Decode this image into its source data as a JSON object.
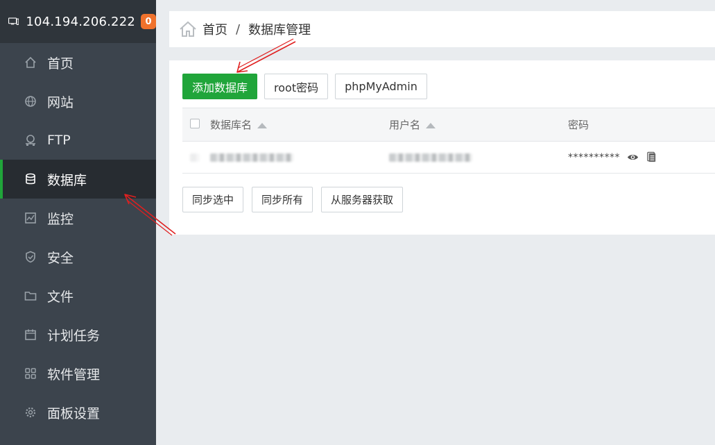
{
  "header": {
    "ip": "104.194.206.222",
    "badge": "0",
    "icon": "monitor-icon"
  },
  "sidebar": {
    "items": [
      {
        "label": "首页",
        "icon": "home-icon",
        "active": false
      },
      {
        "label": "网站",
        "icon": "globe-icon",
        "active": false
      },
      {
        "label": "FTP",
        "icon": "ftp-icon",
        "active": false
      },
      {
        "label": "数据库",
        "icon": "database-icon",
        "active": true
      },
      {
        "label": "监控",
        "icon": "monitor-chart-icon",
        "active": false
      },
      {
        "label": "安全",
        "icon": "shield-icon",
        "active": false
      },
      {
        "label": "文件",
        "icon": "folder-icon",
        "active": false
      },
      {
        "label": "计划任务",
        "icon": "calendar-icon",
        "active": false
      },
      {
        "label": "软件管理",
        "icon": "grid-icon",
        "active": false
      },
      {
        "label": "面板设置",
        "icon": "gear-icon",
        "active": false
      }
    ]
  },
  "breadcrumb": {
    "home": "首页",
    "separator": "/",
    "current": "数据库管理"
  },
  "toolbar": {
    "add_db": "添加数据库",
    "root_password": "root密码",
    "phpmyadmin": "phpMyAdmin"
  },
  "table": {
    "columns": {
      "db_name": "数据库名",
      "username": "用户名",
      "password": "密码"
    },
    "rows": [
      {
        "password_mask": "**********"
      }
    ]
  },
  "actions": {
    "sync_selected": "同步选中",
    "sync_all": "同步所有",
    "fetch_from_server": "从服务器获取"
  },
  "colors": {
    "sidebar_bg": "#3c444d",
    "accent_green": "#20a53a",
    "badge_orange": "#f0722c",
    "annotation_red": "#e02020"
  }
}
